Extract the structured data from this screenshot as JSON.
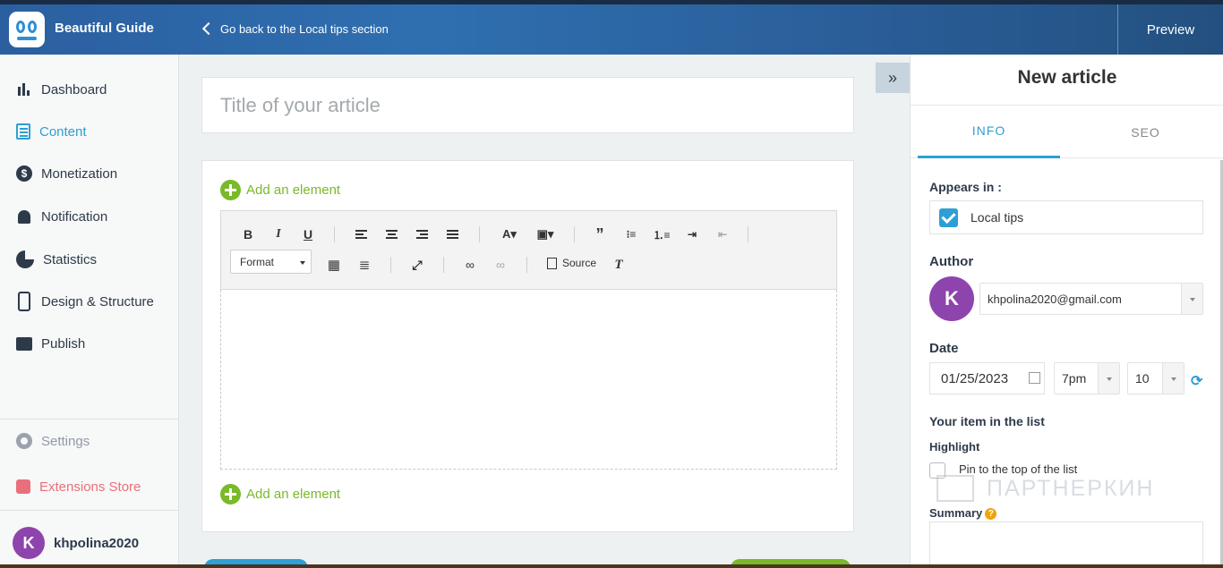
{
  "header": {
    "app_title": "Beautiful Guide",
    "back_label": "Go back to the Local tips section",
    "preview_label": "Preview"
  },
  "sidebar": {
    "items": [
      {
        "label": "Dashboard",
        "icon": "bar-chart-icon"
      },
      {
        "label": "Content",
        "icon": "document-icon",
        "active": true
      },
      {
        "label": "Monetization",
        "icon": "dollar-coin-icon"
      },
      {
        "label": "Notification",
        "icon": "bell-icon"
      },
      {
        "label": "Statistics",
        "icon": "pie-chart-icon"
      },
      {
        "label": "Design & Structure",
        "icon": "phone-icon"
      },
      {
        "label": "Publish",
        "icon": "storefront-icon"
      }
    ],
    "settings_label": "Settings",
    "store_label": "Extensions Store",
    "user": {
      "avatar_letter": "K",
      "name": "khpolina2020"
    }
  },
  "editor": {
    "title_placeholder": "Title of your article",
    "add_element_label": "Add an element",
    "format_label": "Format",
    "source_label": "Source"
  },
  "panel": {
    "title": "New article",
    "tabs": [
      "INFO",
      "SEO"
    ],
    "active_tab": "INFO",
    "appears_in_label": "Appears in :",
    "appears_in_value": "Local tips",
    "author_label": "Author",
    "author_avatar_letter": "K",
    "author_email": "khpolina2020@gmail.com",
    "date_label": "Date",
    "date_value": "01/25/2023",
    "hour_value": "7pm",
    "minute_value": "10",
    "list_label": "Your item in the list",
    "highlight_label": "Highlight",
    "pin_label": "Pin to the top of the list",
    "summary_label": "Summary"
  },
  "watermark": "ПАРТНЕРКИН",
  "colors": {
    "accent": "#2e9fd4",
    "green": "#7ab929",
    "avatar": "#8e44ad",
    "store": "#e9707a"
  }
}
